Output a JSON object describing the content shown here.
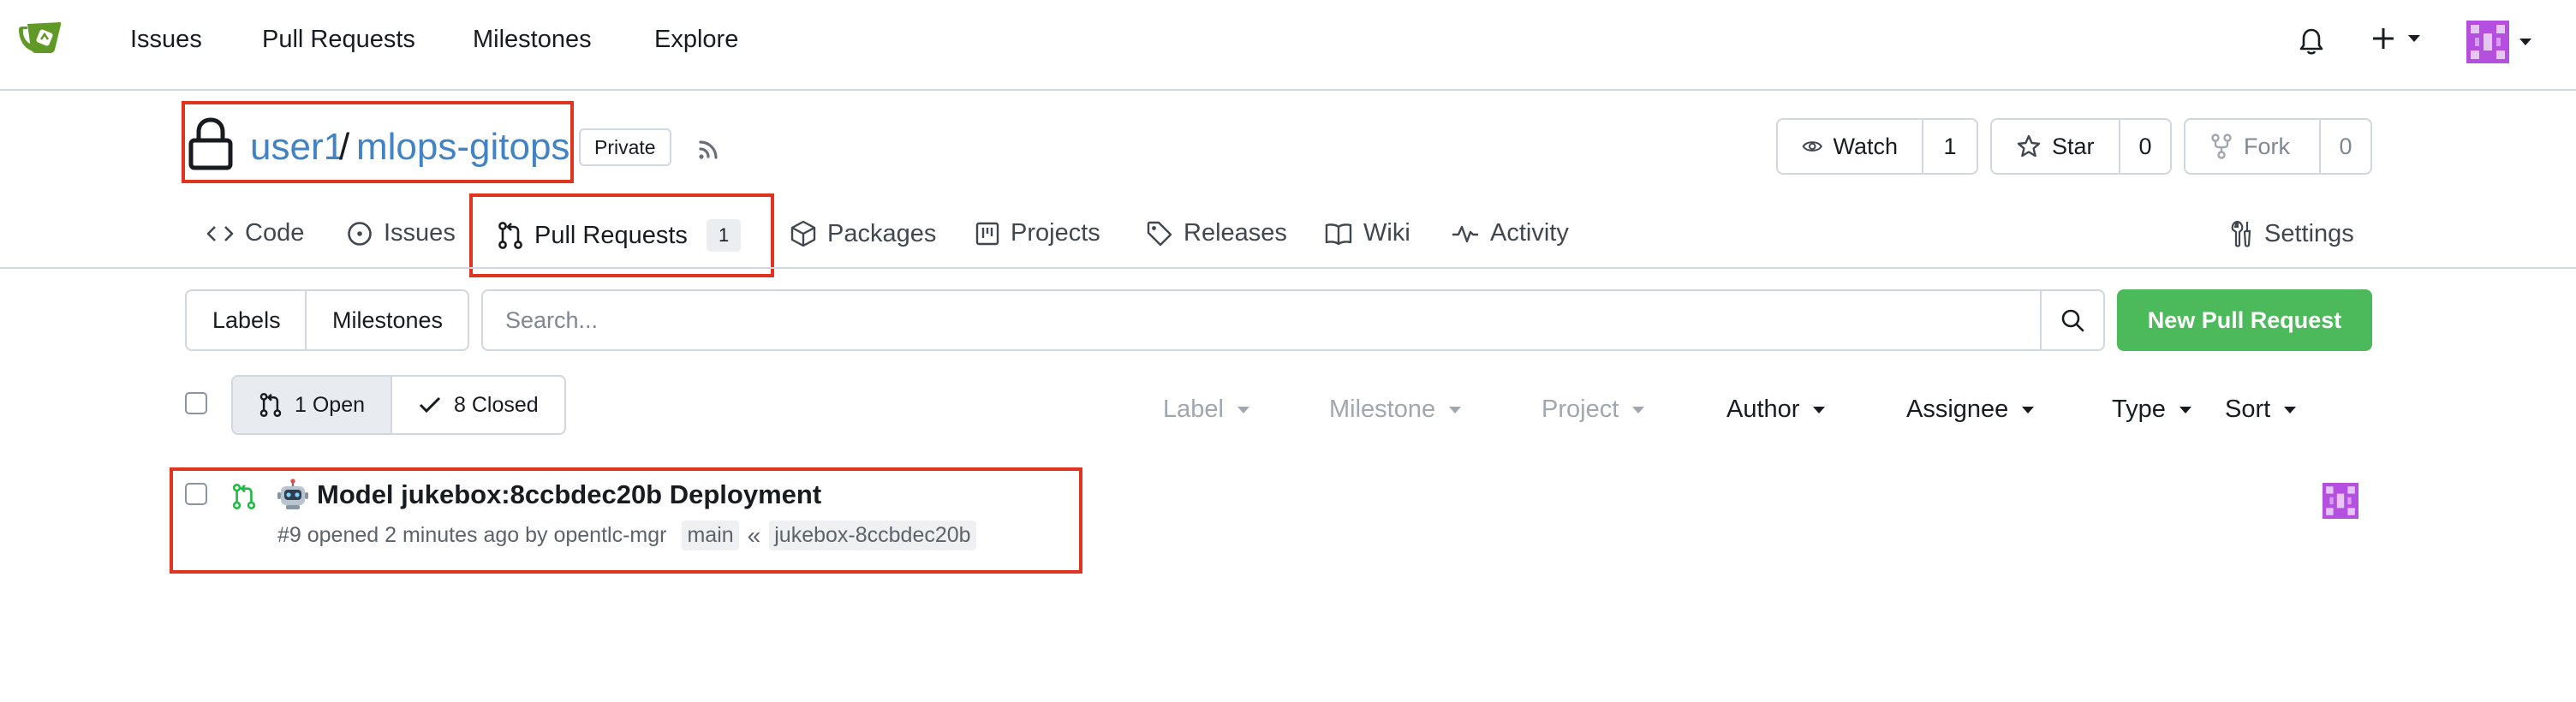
{
  "navbar": {
    "links": [
      "Issues",
      "Pull Requests",
      "Milestones",
      "Explore"
    ]
  },
  "repo": {
    "owner": "user1",
    "slash": "/",
    "name": "mlops-gitops",
    "visibility": "Private",
    "watch": {
      "label": "Watch",
      "count": "1"
    },
    "star": {
      "label": "Star",
      "count": "0"
    },
    "fork": {
      "label": "Fork",
      "count": "0"
    }
  },
  "tabs": {
    "code": "Code",
    "issues": "Issues",
    "pull_requests": "Pull Requests",
    "pull_requests_count": "1",
    "packages": "Packages",
    "projects": "Projects",
    "releases": "Releases",
    "wiki": "Wiki",
    "activity": "Activity",
    "settings": "Settings"
  },
  "toolbar": {
    "labels": "Labels",
    "milestones": "Milestones",
    "search_placeholder": "Search...",
    "new_pr": "New Pull Request"
  },
  "state": {
    "open": "1 Open",
    "closed": "8 Closed"
  },
  "filters": {
    "label": "Label",
    "milestone": "Milestone",
    "project": "Project",
    "author": "Author",
    "assignee": "Assignee",
    "type": "Type",
    "sort": "Sort"
  },
  "pull_requests": [
    {
      "title": "Model jukebox:8ccbdec20b Deployment",
      "meta": "#9 opened 2 minutes ago by opentlc-mgr",
      "base": "main",
      "arrow": "«",
      "head": "jukebox-8ccbdec20b"
    }
  ],
  "colors": {
    "link": "#4183c4",
    "primary_green": "#4cb95a",
    "highlight": "#e0341f",
    "avatar": "#b44fe0"
  }
}
